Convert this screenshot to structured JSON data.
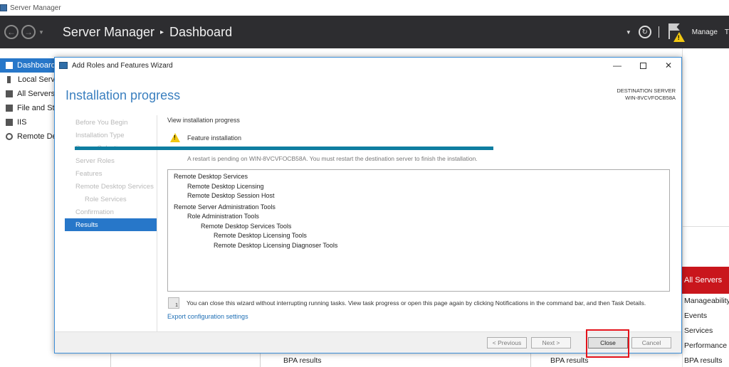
{
  "app": {
    "window_title": "Server Manager",
    "breadcrumb_app": "Server Manager",
    "breadcrumb_separator": "▸",
    "breadcrumb_page": "Dashboard",
    "menu_manage": "Manage",
    "menu_tools_partial": "T"
  },
  "sidebar": {
    "items": [
      {
        "label": "Dashboard",
        "icon": "dashboard-icon",
        "active": true
      },
      {
        "label": "Local Server",
        "icon": "server-icon",
        "active": false
      },
      {
        "label": "All Servers",
        "icon": "servers-icon",
        "active": false
      },
      {
        "label": "File and Storage Services",
        "icon": "storage-icon",
        "active": false
      },
      {
        "label": "IIS",
        "icon": "iis-icon",
        "active": false
      },
      {
        "label": "Remote Desktop Services",
        "icon": "remote-desktop-icon",
        "active": false
      }
    ]
  },
  "background": {
    "all_servers_tile": "All Servers",
    "links": [
      "Manageability",
      "Events",
      "Services",
      "Performance",
      "BPA results"
    ],
    "bpa_1": "BPA results",
    "bpa_2": "BPA results",
    "accent_red": "#c9161c"
  },
  "wizard": {
    "title": "Add Roles and Features Wizard",
    "heading": "Installation progress",
    "destination_label": "DESTINATION SERVER",
    "destination_server": "WIN-8VCVFOCB58A",
    "steps": [
      {
        "label": "Before You Begin",
        "sub": false,
        "active": false
      },
      {
        "label": "Installation Type",
        "sub": false,
        "active": false
      },
      {
        "label": "Server Selection",
        "sub": false,
        "active": false
      },
      {
        "label": "Server Roles",
        "sub": false,
        "active": false
      },
      {
        "label": "Features",
        "sub": false,
        "active": false
      },
      {
        "label": "Remote Desktop Services",
        "sub": false,
        "active": false
      },
      {
        "label": "Role Services",
        "sub": true,
        "active": false
      },
      {
        "label": "Confirmation",
        "sub": false,
        "active": false
      },
      {
        "label": "Results",
        "sub": false,
        "active": true
      }
    ],
    "view_label": "View installation progress",
    "feature_label": "Feature installation",
    "progress": 1.0,
    "restart_message": "A restart is pending on WIN-8VCVFOCB58A. You must restart the destination server to finish the installation.",
    "results": [
      {
        "text": "Remote Desktop Services",
        "level": 0
      },
      {
        "text": "Remote Desktop Licensing",
        "level": 1
      },
      {
        "text": "Remote Desktop Session Host",
        "level": 1
      },
      {
        "text": "Remote Server Administration Tools",
        "level": 0
      },
      {
        "text": "Role Administration Tools",
        "level": 1
      },
      {
        "text": "Remote Desktop Services Tools",
        "level": 2
      },
      {
        "text": "Remote Desktop Licensing Tools",
        "level": 3
      },
      {
        "text": "Remote Desktop Licensing Diagnoser Tools",
        "level": 3
      }
    ],
    "note": "You can close this wizard without interrupting running tasks. View task progress or open this page again by clicking Notifications in the command bar, and then Task Details.",
    "export_link": "Export configuration settings",
    "buttons": {
      "previous": "< Previous",
      "next": "Next >",
      "close": "Close",
      "cancel": "Cancel"
    },
    "accent_blue": "#2777c9",
    "progress_color": "#0e7ea1"
  }
}
